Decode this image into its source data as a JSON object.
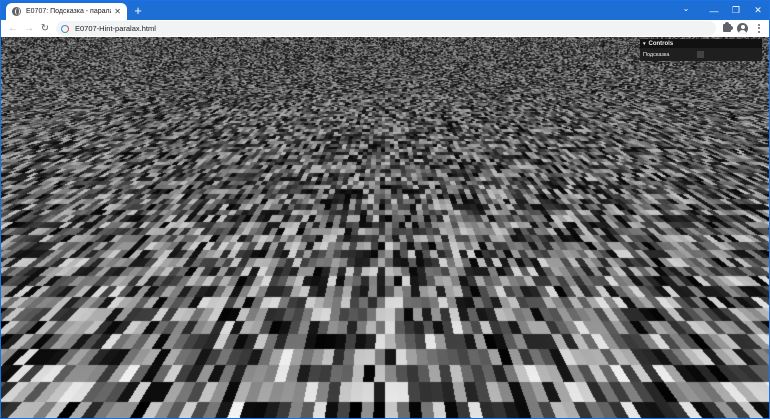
{
  "browser": {
    "tab": {
      "title": "E0707: Подсказка - паралакс",
      "close_glyph": "✕"
    },
    "new_tab_glyph": "+",
    "window_controls": {
      "tab_search_glyph": "⌄",
      "minimize_glyph": "—",
      "maximize_glyph": "❐",
      "close_glyph": "✕"
    },
    "toolbar": {
      "back_glyph": "←",
      "forward_glyph": "→",
      "reload_glyph": "↻",
      "url": "E0707-Hint-paralax.html",
      "icons": [
        "back-arrow-icon",
        "forward-arrow-icon",
        "reload-icon",
        "google-icon",
        "extensions-puzzle-icon",
        "profile-icon",
        "menu-kebab-icon"
      ]
    }
  },
  "page": {
    "background": "grayscale noise texture plane",
    "colors": {
      "browser_accent": "#1d6fd6",
      "gui_bg": "#1f1f1f",
      "gui_title_bg": "#111111"
    }
  },
  "controls": {
    "title": "Controls",
    "caret_glyph": "▾",
    "rows": [
      {
        "label": "Подсказка",
        "type": "checkbox",
        "checked": false
      }
    ]
  }
}
